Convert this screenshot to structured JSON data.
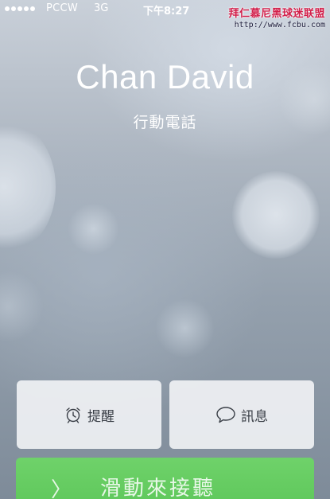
{
  "status_bar": {
    "carrier": "PCCW",
    "network": "3G",
    "time": "下午8:27"
  },
  "watermark": {
    "title": "拜仁慕尼黑球迷联盟",
    "url": "http://www.fcbu.com"
  },
  "caller": {
    "name": "Chan David",
    "type": "行動電話"
  },
  "actions": {
    "remind_label": "提醒",
    "remind_icon": "alarm-clock-icon",
    "message_label": "訊息",
    "message_icon": "speech-bubble-icon"
  },
  "slider": {
    "label": "滑動來接聽",
    "icon": "chevron-right-icon",
    "color": "#5cc659"
  }
}
